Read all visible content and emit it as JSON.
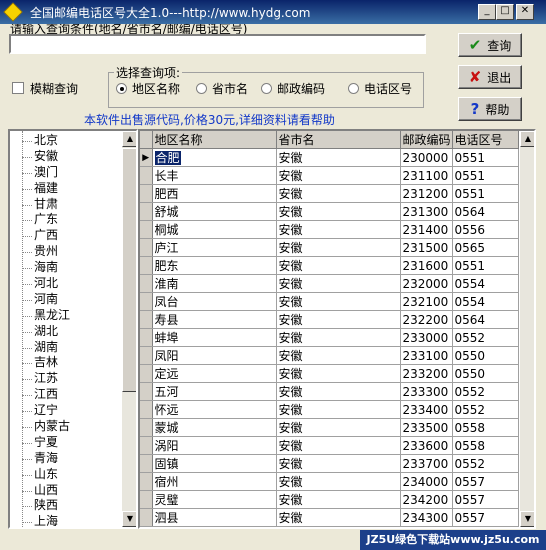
{
  "window": {
    "title": "全国邮编电话区号大全1.0---http://www.hydg.com"
  },
  "search": {
    "cut_label": "请输入查询条件(地名/省市名/邮编/电话区号)",
    "value": ""
  },
  "buttons": {
    "query": "查询",
    "exit": "退出",
    "help": "帮助"
  },
  "fuzzy": {
    "label": "模糊查询",
    "checked": false
  },
  "query_options": {
    "title": "选择查询项:",
    "options": [
      "地区名称",
      "省市名",
      "邮政编码",
      "电话区号"
    ],
    "selected": "地区名称"
  },
  "promo_text": "本软件出售源代码,价格30元,详细资料请看帮助",
  "provinces": [
    "北京",
    "安徽",
    "澳门",
    "福建",
    "甘肃",
    "广东",
    "广西",
    "贵州",
    "海南",
    "河北",
    "河南",
    "黑龙江",
    "湖北",
    "湖南",
    "吉林",
    "江苏",
    "江西",
    "辽宁",
    "内蒙古",
    "宁夏",
    "青海",
    "山东",
    "山西",
    "陕西",
    "上海"
  ],
  "grid": {
    "columns": [
      "地区名称",
      "省市名",
      "邮政编码",
      "电话区号"
    ],
    "rows": [
      [
        "合肥",
        "安徽",
        "230000",
        "0551"
      ],
      [
        "长丰",
        "安徽",
        "231100",
        "0551"
      ],
      [
        "肥西",
        "安徽",
        "231200",
        "0551"
      ],
      [
        "舒城",
        "安徽",
        "231300",
        "0564"
      ],
      [
        "桐城",
        "安徽",
        "231400",
        "0556"
      ],
      [
        "庐江",
        "安徽",
        "231500",
        "0565"
      ],
      [
        "肥东",
        "安徽",
        "231600",
        "0551"
      ],
      [
        "淮南",
        "安徽",
        "232000",
        "0554"
      ],
      [
        "凤台",
        "安徽",
        "232100",
        "0554"
      ],
      [
        "寿县",
        "安徽",
        "232200",
        "0564"
      ],
      [
        "蚌埠",
        "安徽",
        "233000",
        "0552"
      ],
      [
        "凤阳",
        "安徽",
        "233100",
        "0550"
      ],
      [
        "定远",
        "安徽",
        "233200",
        "0550"
      ],
      [
        "五河",
        "安徽",
        "233300",
        "0552"
      ],
      [
        "怀远",
        "安徽",
        "233400",
        "0552"
      ],
      [
        "蒙城",
        "安徽",
        "233500",
        "0558"
      ],
      [
        "涡阳",
        "安徽",
        "233600",
        "0558"
      ],
      [
        "固镇",
        "安徽",
        "233700",
        "0552"
      ],
      [
        "宿州",
        "安徽",
        "234000",
        "0557"
      ],
      [
        "灵璧",
        "安徽",
        "234200",
        "0557"
      ],
      [
        "泗县",
        "安徽",
        "234300",
        "0557"
      ]
    ]
  },
  "watermark": "JZ5U绿色下载站www.jz5u.com"
}
